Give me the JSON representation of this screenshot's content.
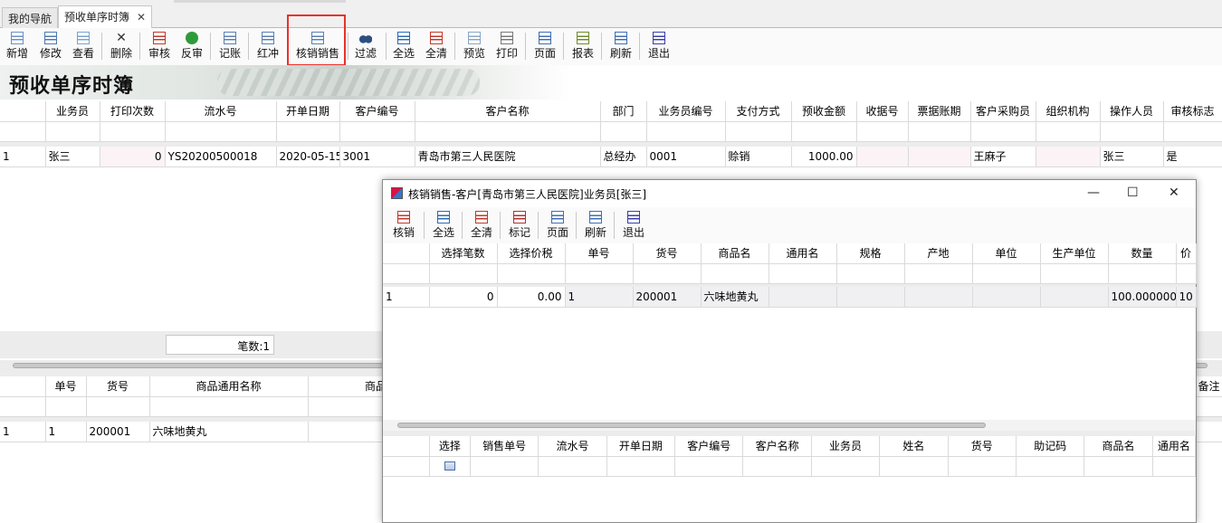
{
  "tabs": [
    {
      "label": "我的导航"
    },
    {
      "label": "预收单序时簿",
      "close": "✕"
    }
  ],
  "toolbar": [
    {
      "label": "新增",
      "icon": "new-doc-icon"
    },
    {
      "label": "修改",
      "icon": "edit-icon"
    },
    {
      "label": "查看",
      "icon": "view-icon"
    },
    {
      "label": "删除",
      "icon": "delete-icon"
    },
    {
      "label": "审核",
      "icon": "audit-icon"
    },
    {
      "label": "反审",
      "icon": "unaudit-icon"
    },
    {
      "label": "记账",
      "icon": "post-icon"
    },
    {
      "label": "红冲",
      "icon": "red-reverse-icon"
    },
    {
      "label": "核销销售",
      "icon": "writeoff-sales-icon"
    },
    {
      "label": "过滤",
      "icon": "filter-icon"
    },
    {
      "label": "全选",
      "icon": "select-all-icon"
    },
    {
      "label": "全清",
      "icon": "clear-all-icon"
    },
    {
      "label": "预览",
      "icon": "preview-icon"
    },
    {
      "label": "打印",
      "icon": "print-icon"
    },
    {
      "label": "页面",
      "icon": "page-icon"
    },
    {
      "label": "报表",
      "icon": "report-icon"
    },
    {
      "label": "刷新",
      "icon": "refresh-icon"
    },
    {
      "label": "退出",
      "icon": "exit-icon"
    }
  ],
  "banner": {
    "title": "预收单序时簿"
  },
  "main_table": {
    "headers": [
      "",
      "业务员",
      "打印次数",
      "流水号",
      "开单日期",
      "客户编号",
      "客户名称",
      "部门",
      "业务员编号",
      "支付方式",
      "预收金额",
      "收据号",
      "票据账期",
      "客户采购员",
      "组织机构",
      "操作人员",
      "审核标志"
    ],
    "rows": [
      [
        "1",
        "张三",
        "0",
        "YS20200500018",
        "2020-05-15",
        "3001",
        "青岛市第三人民医院",
        "总经办",
        "0001",
        "赊销",
        "1000.00",
        "",
        "",
        "王麻子",
        "",
        "张三",
        "是"
      ]
    ]
  },
  "count": {
    "label": "笔数:1"
  },
  "detail_table": {
    "headers": [
      "",
      "单号",
      "货号",
      "商品通用名称",
      "商品"
    ],
    "extra_header": "备注",
    "rows": [
      [
        "1",
        "1",
        "200001",
        "六味地黄丸",
        ""
      ]
    ]
  },
  "popup": {
    "title": "核销销售-客户[青岛市第三人民医院]业务员[张三]",
    "controls": {
      "minimize": "—",
      "maximize": "☐",
      "close": "✕"
    },
    "toolbar": [
      {
        "label": "核销",
        "icon": "writeoff-icon"
      },
      {
        "label": "全选",
        "icon": "select-all-icon"
      },
      {
        "label": "全清",
        "icon": "clear-all-icon"
      },
      {
        "label": "标记",
        "icon": "mark-icon"
      },
      {
        "label": "页面",
        "icon": "page-icon"
      },
      {
        "label": "刷新",
        "icon": "refresh-icon"
      },
      {
        "label": "退出",
        "icon": "exit-icon"
      }
    ],
    "top_table": {
      "headers": [
        "",
        "选择笔数",
        "选择价税",
        "单号",
        "货号",
        "商品名",
        "通用名",
        "规格",
        "产地",
        "单位",
        "生产单位",
        "数量",
        "价"
      ],
      "rows": [
        [
          "1",
          "0",
          "0.00",
          "1",
          "200001",
          "六味地黄丸",
          "",
          "",
          "",
          "",
          "",
          "100.000000",
          "10"
        ]
      ]
    },
    "bottom_table": {
      "headers": [
        "",
        "选择",
        "销售单号",
        "流水号",
        "开单日期",
        "客户编号",
        "客户名称",
        "业务员",
        "姓名",
        "货号",
        "助记码",
        "商品名",
        "通用名"
      ]
    }
  }
}
